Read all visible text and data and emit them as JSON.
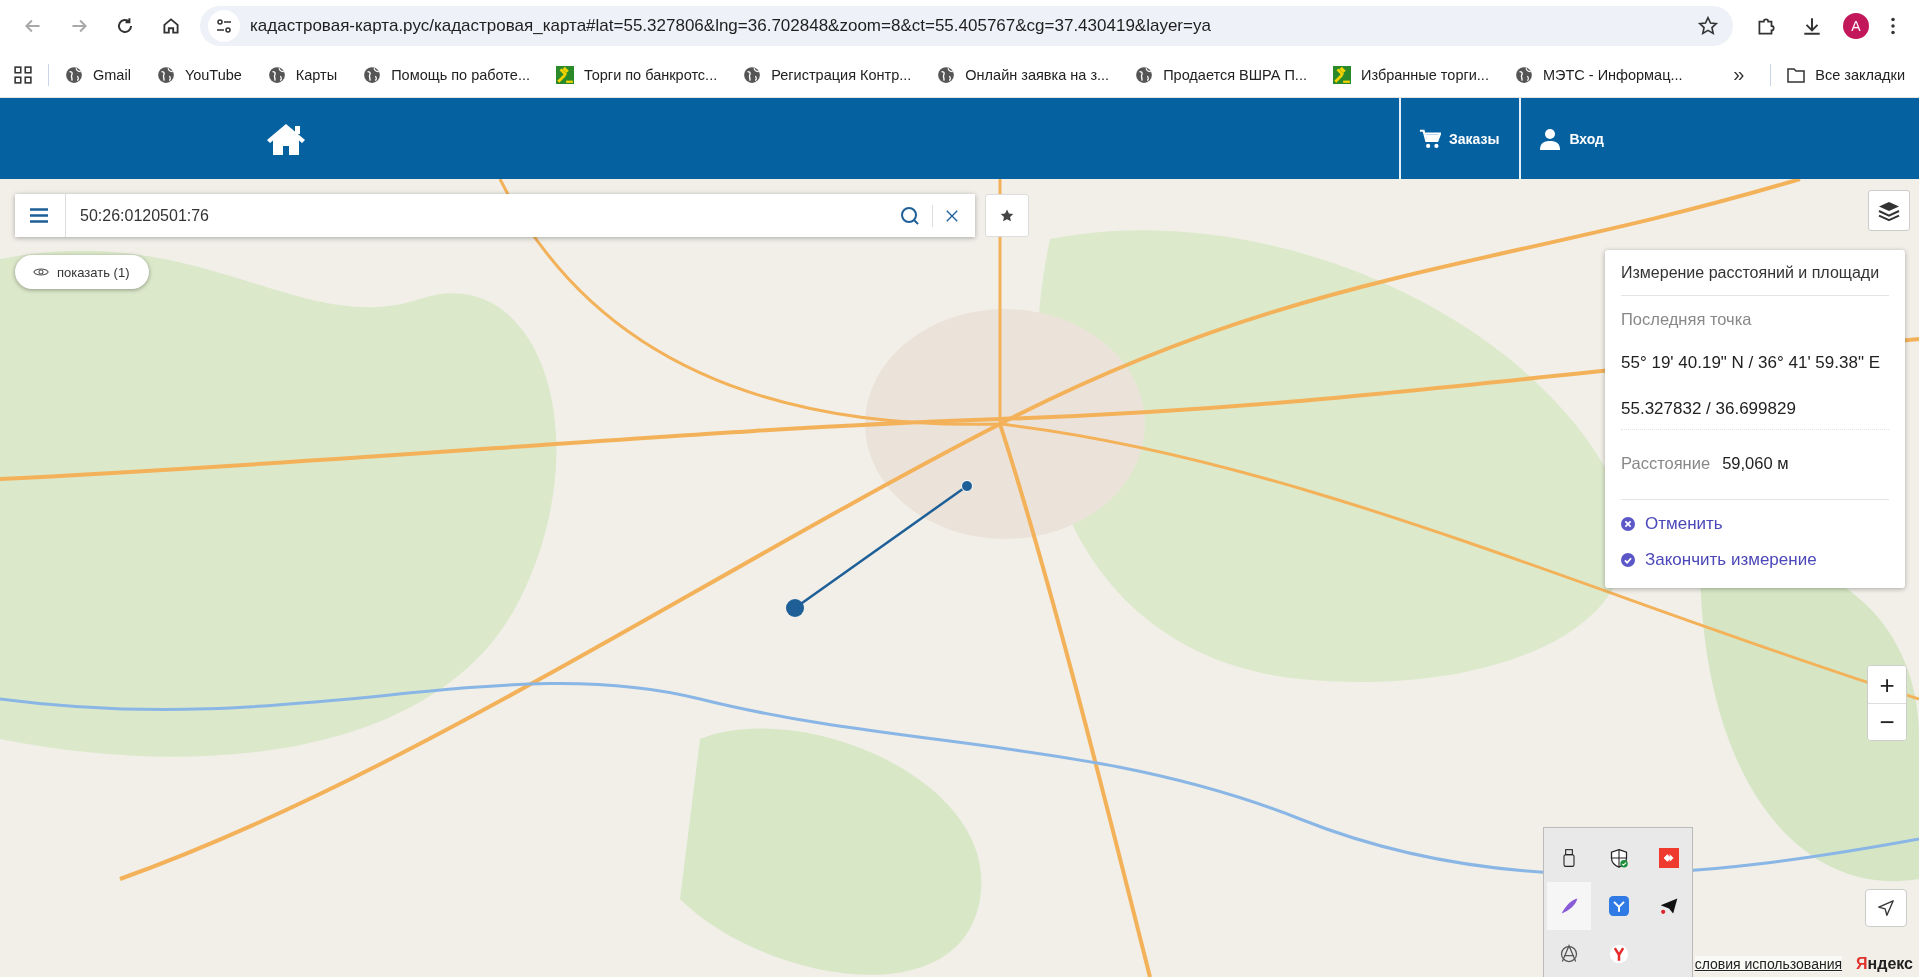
{
  "browser": {
    "address": "кадастровая-карта.рус/кадастровая_карта#lat=55.327806&lng=36.702848&zoom=8&ct=55.405767&cg=37.430419&layer=ya",
    "profile_initial": "A",
    "bookmarks": [
      {
        "label": "Gmail",
        "kind": "globe"
      },
      {
        "label": "YouTube",
        "kind": "globe"
      },
      {
        "label": "Карты",
        "kind": "globe"
      },
      {
        "label": "Помощь по работе...",
        "kind": "globe"
      },
      {
        "label": "Торги по банкротс...",
        "kind": "gavel"
      },
      {
        "label": "Регистрация Контр...",
        "kind": "globe"
      },
      {
        "label": "Онлайн заявка на з...",
        "kind": "globe"
      },
      {
        "label": "Продается ВШРА П...",
        "kind": "globe"
      },
      {
        "label": "Избранные торги...",
        "kind": "gavel"
      },
      {
        "label": "МЭТС - Информац...",
        "kind": "globe"
      }
    ],
    "more": "»",
    "all_bookmarks": "Все закладки"
  },
  "header": {
    "nav": [
      {
        "label": "Заказы",
        "kind": "cart"
      },
      {
        "label": "Вход",
        "kind": "user"
      }
    ]
  },
  "search": {
    "value": "50:26:0120501:76"
  },
  "show_button": "показать (1)",
  "measure_panel": {
    "title": "Измерение расстояний и площади",
    "last_point_label": "Последняя точка",
    "dms": "55° 19' 40.19\" N / 36° 41' 59.38\" E",
    "decimal": "55.327832 / 36.699829",
    "distance_label": "Расстояние",
    "distance": "59,060 м",
    "actions": [
      {
        "label": "Отменить",
        "kind": "cancel"
      },
      {
        "label": "Закончить измерение",
        "kind": "finish"
      }
    ]
  },
  "zoom": {
    "in": "+",
    "out": "−"
  },
  "attribution": {
    "terms": "словия использования",
    "brand": "Яндекс"
  }
}
